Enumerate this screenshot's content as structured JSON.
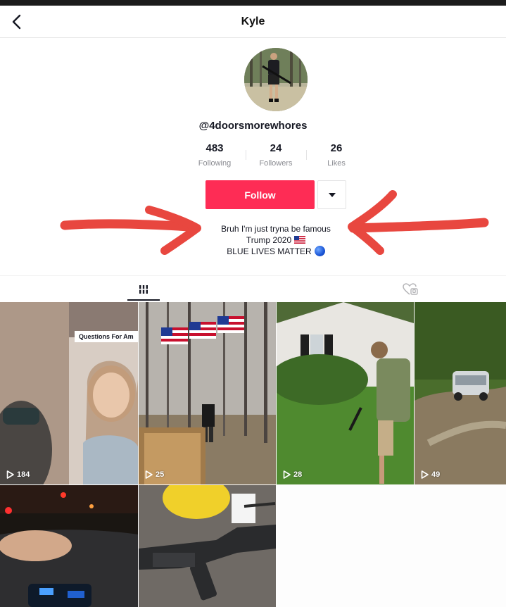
{
  "header": {
    "title": "Kyle"
  },
  "profile": {
    "username": "@4doorsmorewhores",
    "stats": [
      {
        "value": "483",
        "label": "Following"
      },
      {
        "value": "24",
        "label": "Followers"
      },
      {
        "value": "26",
        "label": "Likes"
      }
    ],
    "follow_label": "Follow",
    "bio": [
      "Bruh I'm just tryna be famous",
      "Trump 2020",
      "BLUE LIVES MATTER"
    ]
  },
  "videos": [
    {
      "views": "184",
      "caption": "Questions For Am"
    },
    {
      "views": "25"
    },
    {
      "views": "28"
    },
    {
      "views": "49"
    },
    {
      "views": ""
    },
    {
      "views": ""
    }
  ],
  "colors": {
    "accent": "#fe2c55",
    "annotation_arrow": "#e8473f"
  },
  "icons": [
    "chevron-left-icon",
    "caret-down-icon",
    "grid-icon",
    "liked-heart-icon",
    "play-icon",
    "us-flag-icon",
    "blue-circle-icon"
  ]
}
